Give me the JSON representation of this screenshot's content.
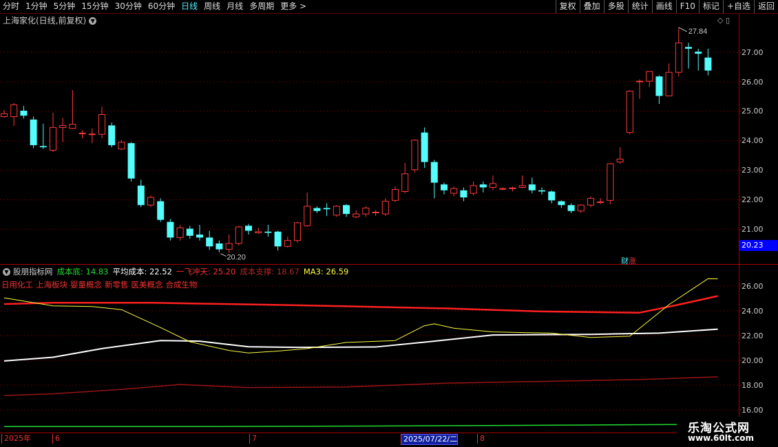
{
  "periods": [
    "分时",
    "1分钟",
    "5分钟",
    "15分钟",
    "30分钟",
    "60分钟",
    "日线",
    "周线",
    "月线",
    "多周期",
    "更多 >"
  ],
  "active_period": "日线",
  "tools": [
    "复权",
    "叠加",
    "多股",
    "统计",
    "画线",
    "F10",
    "标记",
    "+自选",
    "返回"
  ],
  "main_title": "上海家化(日线,前复权)",
  "main_axis_ticks": [
    "27.00",
    "26.00",
    "25.00",
    "24.00",
    "23.00",
    "22.00",
    "21.00"
  ],
  "high_label": "27.84",
  "low_label": "20.20",
  "current_price": "20.23",
  "caizhang_a": "财",
  "caizhang_b": "涨",
  "indicator": {
    "name": "股朋指标网",
    "cost_floor": "成本底: 14.83",
    "avg_cost": "平均成本: 22.52",
    "yifei": "一飞冲天: 25.20",
    "support": "成本支撑: 18.67",
    "ma3": "MA3: 26.59"
  },
  "concepts": [
    "日用化工",
    "上海板块",
    "婴童概念",
    "新零售",
    "医美概念",
    "合成生物"
  ],
  "sub_axis_ticks": [
    "26.00",
    "24.00",
    "22.00",
    "20.00",
    "18.00",
    "16.00"
  ],
  "dates": [
    "2025年",
    "6",
    "7",
    "2025/07/22/二",
    "8"
  ],
  "watermark_1": "乐淘公式网",
  "watermark_2": "www.60lt.com",
  "chart_data": {
    "type": "candlestick",
    "main_ylim": [
      20.0,
      28.0
    ],
    "sub_ylim": [
      14.0,
      27.5
    ],
    "candles": [
      [
        24.82,
        24.92,
        24.78,
        25.05
      ],
      [
        24.82,
        25.22,
        24.5,
        25.28
      ],
      [
        25.02,
        24.85,
        24.75,
        25.18
      ],
      [
        24.72,
        23.85,
        23.75,
        24.82
      ],
      [
        23.82,
        23.78,
        23.72,
        24.58
      ],
      [
        23.68,
        24.45,
        23.62,
        24.95
      ],
      [
        24.45,
        24.52,
        23.95,
        24.78
      ],
      [
        24.42,
        24.56,
        24.4,
        25.72
      ],
      [
        24.25,
        24.26,
        24.08,
        24.36
      ],
      [
        24.22,
        24.23,
        23.92,
        24.42
      ],
      [
        24.22,
        24.89,
        24.08,
        25.15
      ],
      [
        24.52,
        23.85,
        23.78,
        24.62
      ],
      [
        23.72,
        23.95,
        23.68,
        24.02
      ],
      [
        23.92,
        22.72,
        22.62,
        23.95
      ],
      [
        22.48,
        21.82,
        21.75,
        22.68
      ],
      [
        21.82,
        22.08,
        21.75,
        22.15
      ],
      [
        21.95,
        21.32,
        21.25,
        22.05
      ],
      [
        21.25,
        20.72,
        20.62,
        21.35
      ],
      [
        20.72,
        21.05,
        20.62,
        21.15
      ],
      [
        21.02,
        20.78,
        20.68,
        21.12
      ],
      [
        20.82,
        20.72,
        20.62,
        21.15
      ],
      [
        20.72,
        20.42,
        20.3,
        20.95
      ],
      [
        20.52,
        20.32,
        20.22,
        20.62
      ],
      [
        20.32,
        20.52,
        20.2,
        20.82
      ],
      [
        20.52,
        21.08,
        20.45,
        21.12
      ],
      [
        21.12,
        20.95,
        20.82,
        21.18
      ],
      [
        20.88,
        20.92,
        20.85,
        21.05
      ],
      [
        20.92,
        20.88,
        20.75,
        21.15
      ],
      [
        20.92,
        20.42,
        20.28,
        20.95
      ],
      [
        20.42,
        20.62,
        20.38,
        20.75
      ],
      [
        20.62,
        21.22,
        20.55,
        21.25
      ],
      [
        21.12,
        21.78,
        21.08,
        22.25
      ],
      [
        21.72,
        21.62,
        21.55,
        21.78
      ],
      [
        21.72,
        21.68,
        21.45,
        21.88
      ],
      [
        21.48,
        21.78,
        21.42,
        21.82
      ],
      [
        21.82,
        21.52,
        21.42,
        21.85
      ],
      [
        21.42,
        21.52,
        21.38,
        21.65
      ],
      [
        21.52,
        21.72,
        21.42,
        21.78
      ],
      [
        21.58,
        21.58,
        21.45,
        21.65
      ],
      [
        21.52,
        21.95,
        21.45,
        22.05
      ],
      [
        21.98,
        22.35,
        21.92,
        22.45
      ],
      [
        22.28,
        22.88,
        22.22,
        23.25
      ],
      [
        23.02,
        24.02,
        22.92,
        24.05
      ],
      [
        24.28,
        23.28,
        23.08,
        24.45
      ],
      [
        23.28,
        22.58,
        22.05,
        23.35
      ],
      [
        22.52,
        22.32,
        22.18,
        22.58
      ],
      [
        22.22,
        22.38,
        22.12,
        22.45
      ],
      [
        22.32,
        22.08,
        21.95,
        22.42
      ],
      [
        22.22,
        22.48,
        22.15,
        22.62
      ],
      [
        22.52,
        22.42,
        22.25,
        22.62
      ],
      [
        22.42,
        22.55,
        22.32,
        22.82
      ],
      [
        22.38,
        22.38,
        22.32,
        22.42
      ],
      [
        22.4,
        22.4,
        22.28,
        22.45
      ],
      [
        22.42,
        22.48,
        22.38,
        22.82
      ],
      [
        22.52,
        22.32,
        22.22,
        22.75
      ],
      [
        22.32,
        22.28,
        22.18,
        22.42
      ],
      [
        22.28,
        21.98,
        21.88,
        22.32
      ],
      [
        21.95,
        21.82,
        21.72,
        21.98
      ],
      [
        21.82,
        21.62,
        21.55,
        21.88
      ],
      [
        21.62,
        21.82,
        21.55,
        21.85
      ],
      [
        21.82,
        22.05,
        21.75,
        22.12
      ],
      [
        21.92,
        21.93,
        21.85,
        22.05
      ],
      [
        21.98,
        23.22,
        21.85,
        23.25
      ],
      [
        23.28,
        23.38,
        23.22,
        23.78
      ],
      [
        24.28,
        25.68,
        24.22,
        25.72
      ],
      [
        26.02,
        26.02,
        25.42,
        26.08
      ],
      [
        26.02,
        26.35,
        25.82,
        26.35
      ],
      [
        26.18,
        25.52,
        25.25,
        26.22
      ],
      [
        25.52,
        26.32,
        25.52,
        26.62
      ],
      [
        26.32,
        27.32,
        26.18,
        27.84
      ],
      [
        27.18,
        27.12,
        26.45,
        27.32
      ],
      [
        27.02,
        26.95,
        26.38,
        27.12
      ],
      [
        26.82,
        26.38,
        26.22,
        27.12
      ]
    ],
    "series": [
      {
        "name": "成本底",
        "color": "#22dd33"
      },
      {
        "name": "平均成本",
        "color": "#ffffff"
      },
      {
        "name": "一飞冲天",
        "color": "#ff2020"
      },
      {
        "name": "成本支撑",
        "color": "#aa1a1a"
      },
      {
        "name": "MA3",
        "color": "#ffff44"
      }
    ],
    "cost_floor_pts": [
      [
        0,
        14.65
      ],
      [
        20,
        14.65
      ],
      [
        40,
        14.7
      ],
      [
        60,
        14.78
      ],
      [
        73,
        14.83
      ]
    ],
    "avg_cost_pts": [
      [
        0,
        19.95
      ],
      [
        5,
        20.25
      ],
      [
        10,
        20.95
      ],
      [
        16,
        21.6
      ],
      [
        20,
        21.55
      ],
      [
        25,
        21.1
      ],
      [
        30,
        21.05
      ],
      [
        38,
        21.08
      ],
      [
        44,
        21.55
      ],
      [
        50,
        22.05
      ],
      [
        60,
        22.1
      ],
      [
        67,
        22.2
      ],
      [
        73,
        22.52
      ]
    ],
    "yifei_pts": [
      [
        0,
        24.55
      ],
      [
        5,
        24.65
      ],
      [
        15,
        24.65
      ],
      [
        30,
        24.45
      ],
      [
        45,
        24.2
      ],
      [
        55,
        23.95
      ],
      [
        65,
        23.85
      ],
      [
        69,
        24.5
      ],
      [
        73,
        25.2
      ]
    ],
    "support_pts": [
      [
        0,
        17.15
      ],
      [
        5,
        17.3
      ],
      [
        12,
        17.65
      ],
      [
        18,
        18.05
      ],
      [
        25,
        17.8
      ],
      [
        35,
        17.85
      ],
      [
        45,
        18.15
      ],
      [
        55,
        18.3
      ],
      [
        65,
        18.45
      ],
      [
        73,
        18.67
      ]
    ],
    "ma3_pts": [
      [
        0,
        25.05
      ],
      [
        5,
        24.4
      ],
      [
        9,
        24.35
      ],
      [
        12,
        24.1
      ],
      [
        16,
        22.65
      ],
      [
        19,
        21.5
      ],
      [
        23,
        20.8
      ],
      [
        25,
        20.6
      ],
      [
        28,
        20.75
      ],
      [
        31,
        20.95
      ],
      [
        35,
        21.45
      ],
      [
        40,
        21.6
      ],
      [
        43,
        22.8
      ],
      [
        44,
        22.95
      ],
      [
        46,
        22.6
      ],
      [
        50,
        22.3
      ],
      [
        56,
        22.2
      ],
      [
        60,
        21.85
      ],
      [
        64,
        21.95
      ],
      [
        68,
        24.5
      ],
      [
        72,
        26.6
      ],
      [
        73,
        26.59
      ]
    ]
  }
}
